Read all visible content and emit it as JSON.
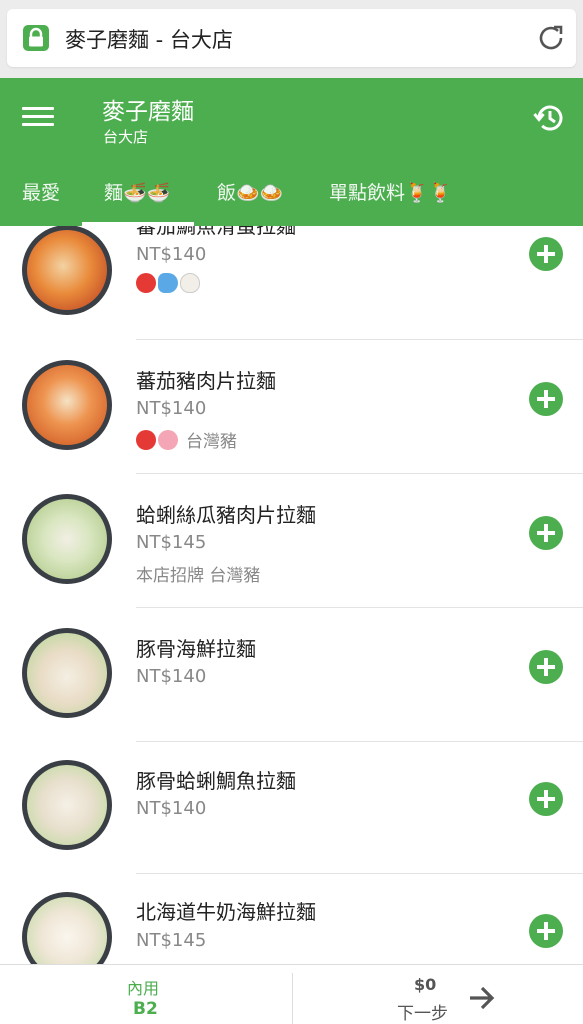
{
  "browser": {
    "url_text": "麥子磨麵 - 台大店"
  },
  "header": {
    "title": "麥子磨麵",
    "subtitle": "台大店"
  },
  "tabs": [
    {
      "label": "最愛"
    },
    {
      "label": "麵🍜🍜"
    },
    {
      "label": "飯🍛🍛"
    },
    {
      "label": "單點飲料🍹🍹"
    }
  ],
  "items": [
    {
      "name": "蕃茄鯛魚滑蛋拉麵",
      "price": "NT$140",
      "tags": "",
      "tag_icons": [
        "tomato-icon",
        "fish-icon",
        "egg-icon"
      ]
    },
    {
      "name": "蕃茄豬肉片拉麵",
      "price": "NT$140",
      "tags": "台灣豬",
      "tag_icons": [
        "tomato-icon",
        "pig-icon"
      ]
    },
    {
      "name": "蛤蜊絲瓜豬肉片拉麵",
      "price": "NT$145",
      "tags": "本店招牌 台灣豬",
      "tag_icons": []
    },
    {
      "name": "豚骨海鮮拉麵",
      "price": "NT$140",
      "tags": "",
      "tag_icons": []
    },
    {
      "name": "豚骨蛤蜊鯛魚拉麵",
      "price": "NT$140",
      "tags": "",
      "tag_icons": []
    },
    {
      "name": "北海道牛奶海鮮拉麵",
      "price": "NT$145",
      "tags": "",
      "tag_icons": []
    }
  ],
  "bottom": {
    "dine_label": "內用",
    "table": "B2",
    "total": "$0",
    "next_label": "下一步"
  },
  "colors": {
    "primary": "#4cae4f",
    "text": "#222222",
    "muted": "#888888"
  }
}
